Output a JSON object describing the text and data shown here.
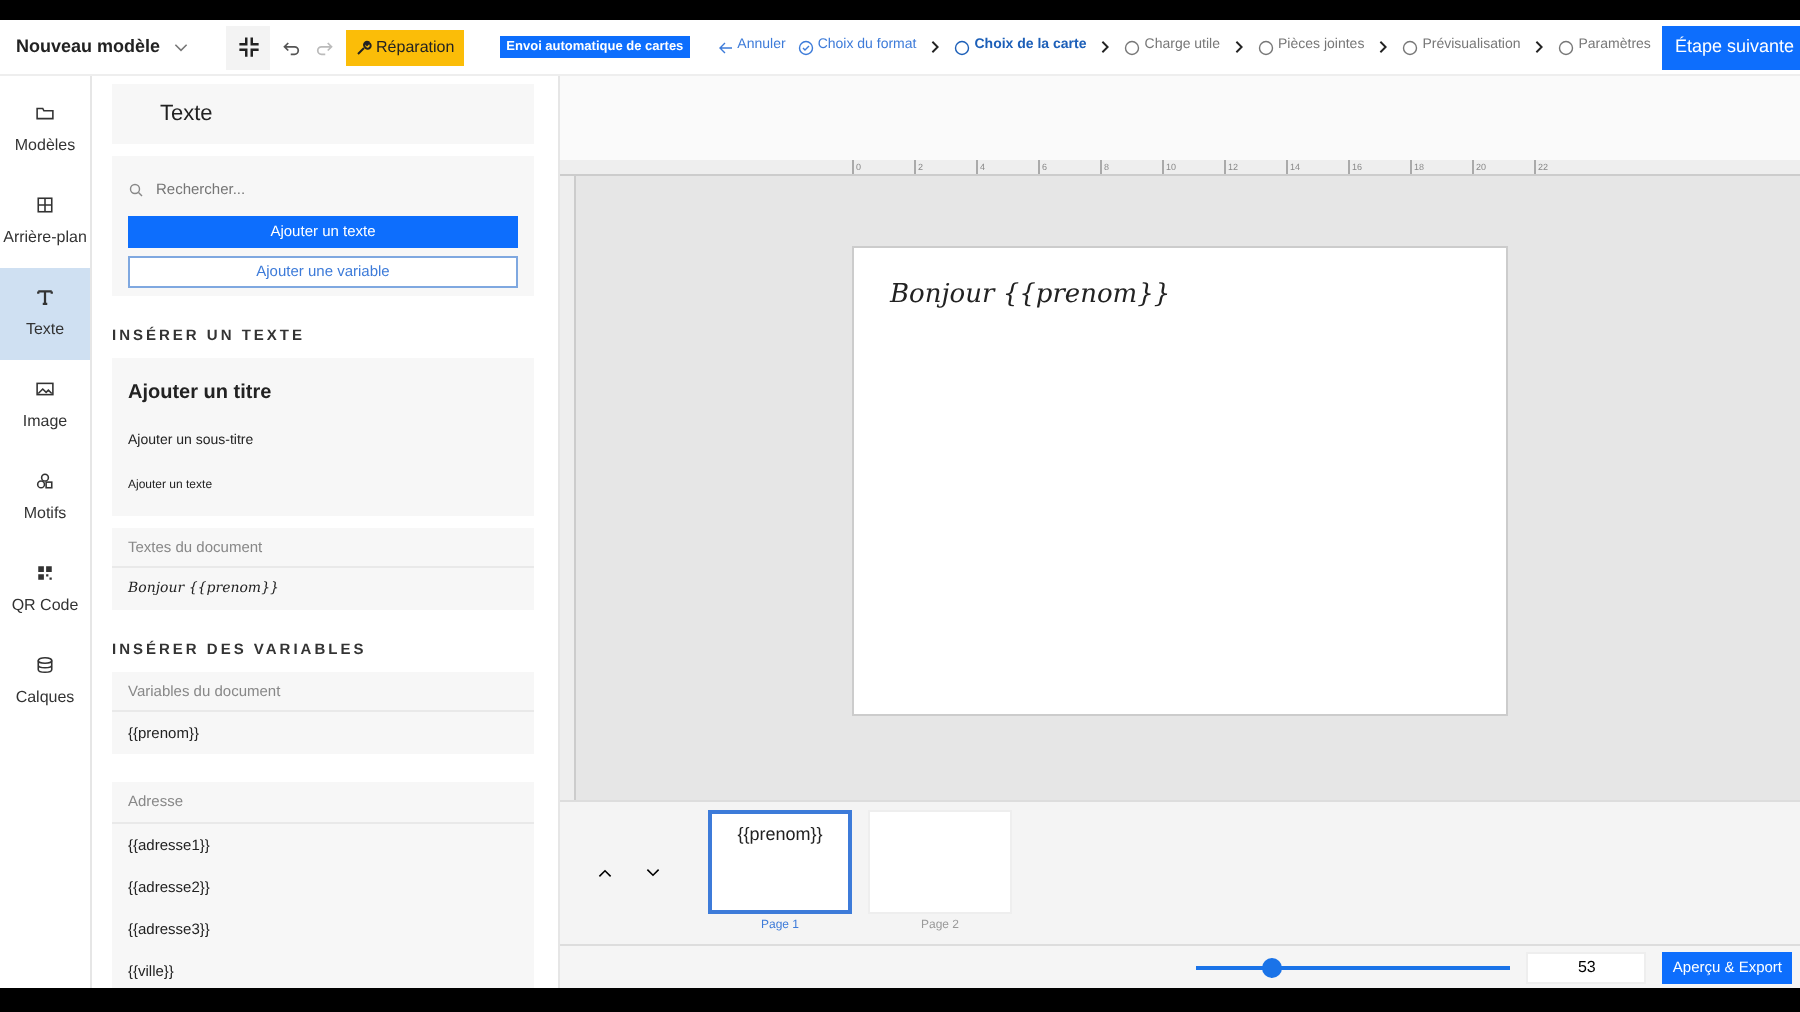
{
  "header": {
    "title": "Nouveau modèle",
    "repair_button": "Réparation",
    "badge": "Envoi automatique de cartes",
    "cancel": "Annuler",
    "steps": [
      {
        "label": "Choix du format",
        "checked": true,
        "selected": false
      },
      {
        "label": "Choix de la carte",
        "checked": false,
        "selected": true
      },
      {
        "label": "Charge utile",
        "checked": false,
        "selected": false
      },
      {
        "label": "Pièces jointes",
        "checked": false,
        "selected": false
      },
      {
        "label": "Prévisualisation",
        "checked": false,
        "selected": false
      },
      {
        "label": "Paramètres",
        "checked": false,
        "selected": false
      }
    ],
    "next_button": "Étape suivante"
  },
  "sidebar": {
    "items": [
      {
        "label": "Modèles",
        "selected": false
      },
      {
        "label": "Arrière-plan",
        "selected": false
      },
      {
        "label": "Texte",
        "selected": true
      },
      {
        "label": "Image",
        "selected": false
      },
      {
        "label": "Motifs",
        "selected": false
      },
      {
        "label": "QR Code",
        "selected": false
      },
      {
        "label": "Calques",
        "selected": false
      }
    ]
  },
  "panel": {
    "title": "Texte",
    "search": {
      "placeholder": "Rechercher..."
    },
    "add_text_button": "Ajouter un texte",
    "add_variable_button": "Ajouter une variable",
    "insert_text_heading": "INSÉRER UN TEXTE",
    "insert_items": [
      {
        "label": "Ajouter un titre",
        "kind": "title"
      },
      {
        "label": "Ajouter un sous-titre",
        "kind": "subtitle"
      },
      {
        "label": "Ajouter un texte",
        "kind": "body"
      }
    ],
    "document_texts": {
      "heading": "Textes du document",
      "items": [
        "Bonjour {{prenom}}"
      ]
    },
    "insert_variables_heading": "INSÉRER DES VARIABLES",
    "groups": [
      {
        "heading": "Variables du document",
        "items": [
          "{{prenom}}"
        ]
      },
      {
        "heading": "Adresse",
        "items": [
          "{{adresse1}}",
          "{{adresse2}}",
          "{{adresse3}}",
          "{{ville}}"
        ]
      }
    ]
  },
  "canvas": {
    "ruler_ticks": [
      "0",
      "2",
      "4",
      "6",
      "8",
      "10",
      "12",
      "14",
      "16",
      "18",
      "20",
      "22"
    ],
    "card_text": "Bonjour {{prenom}}"
  },
  "pages": [
    {
      "label": "Page 1",
      "text": "{{prenom}}",
      "selected": true
    },
    {
      "label": "Page 2",
      "selected": false
    }
  ],
  "footer": {
    "zoom": {
      "level": 0.24,
      "value": "53"
    },
    "export_button": "Aperçu & Export"
  }
}
